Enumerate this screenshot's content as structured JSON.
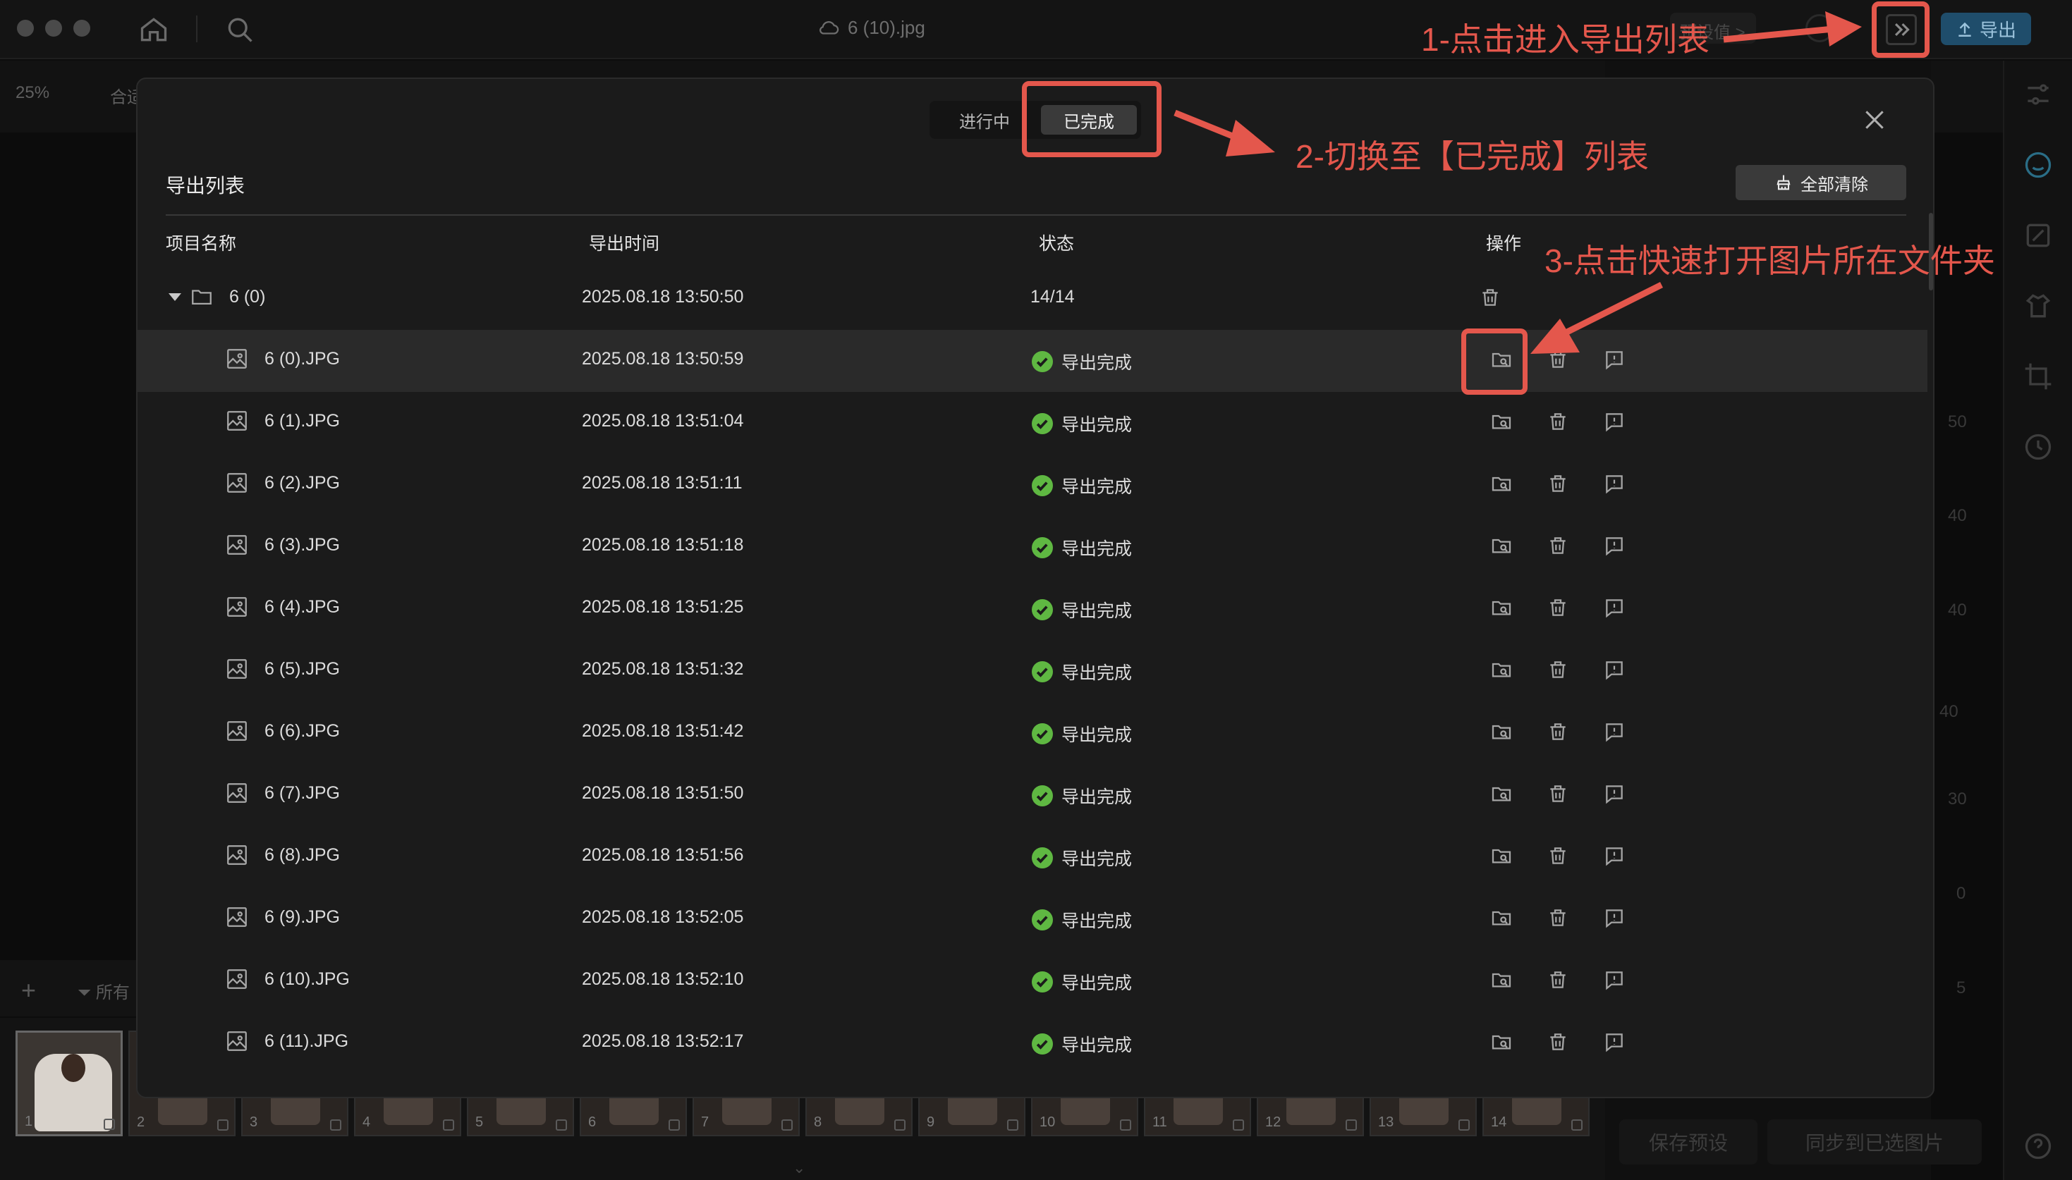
{
  "window": {
    "title": "6 (10).jpg",
    "preset_chip": "预设值 >",
    "export_label": "导出",
    "zoom": "25%",
    "merge_label": "合适"
  },
  "modal": {
    "tabs": [
      {
        "label": "进行中"
      },
      {
        "label": "已完成"
      }
    ],
    "title": "导出列表",
    "clear_all": "全部清除",
    "columns": {
      "name": "项目名称",
      "time": "导出时间",
      "status": "状态",
      "actions": "操作"
    },
    "group": {
      "name": "6 (0)",
      "time": "2025.08.18 13:50:50",
      "count": "14/14"
    },
    "rows": [
      {
        "name": "6 (0).JPG",
        "time": "2025.08.18 13:50:59",
        "status": "导出完成"
      },
      {
        "name": "6 (1).JPG",
        "time": "2025.08.18 13:51:04",
        "status": "导出完成"
      },
      {
        "name": "6 (2).JPG",
        "time": "2025.08.18 13:51:11",
        "status": "导出完成"
      },
      {
        "name": "6 (3).JPG",
        "time": "2025.08.18 13:51:18",
        "status": "导出完成"
      },
      {
        "name": "6 (4).JPG",
        "time": "2025.08.18 13:51:25",
        "status": "导出完成"
      },
      {
        "name": "6 (5).JPG",
        "time": "2025.08.18 13:51:32",
        "status": "导出完成"
      },
      {
        "name": "6 (6).JPG",
        "time": "2025.08.18 13:51:42",
        "status": "导出完成"
      },
      {
        "name": "6 (7).JPG",
        "time": "2025.08.18 13:51:50",
        "status": "导出完成"
      },
      {
        "name": "6 (8).JPG",
        "time": "2025.08.18 13:51:56",
        "status": "导出完成"
      },
      {
        "name": "6 (9).JPG",
        "time": "2025.08.18 13:52:05",
        "status": "导出完成"
      },
      {
        "name": "6 (10).JPG",
        "time": "2025.08.18 13:52:10",
        "status": "导出完成"
      },
      {
        "name": "6 (11).JPG",
        "time": "2025.08.18 13:52:17",
        "status": "导出完成"
      }
    ]
  },
  "annotations": [
    "1-点击进入导出列表",
    "2-切换至【已完成】列表",
    "3-点击快速打开图片所在文件夹"
  ],
  "filmstrip": {
    "filter_label": "所有",
    "thumbs": [
      "1",
      "2",
      "3",
      "4",
      "5",
      "6",
      "7",
      "8",
      "9",
      "10",
      "11",
      "12",
      "13",
      "14"
    ]
  },
  "right_panel": {
    "values": [
      "50",
      "40",
      "40",
      "40",
      "30",
      "0",
      "5"
    ],
    "save_preset": "保存预设",
    "sync": "同步到已选图片"
  },
  "colors": {
    "annotation": "#e4574c",
    "success": "#5fb842",
    "accent": "#1f4d6b"
  }
}
